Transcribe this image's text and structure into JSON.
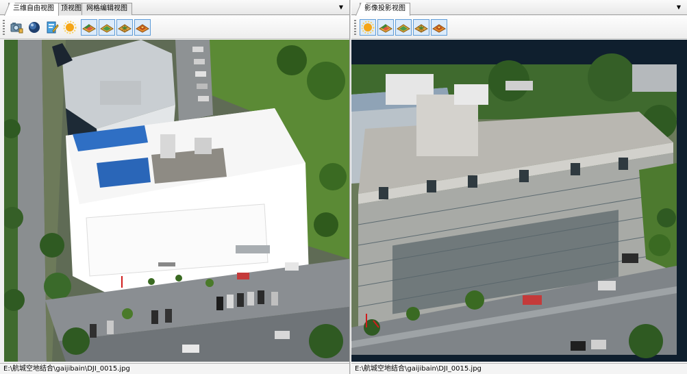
{
  "left_panel": {
    "tabs": [
      {
        "label": "三维自由视图",
        "active": true
      },
      {
        "label": "顶视图",
        "active": false
      },
      {
        "label": "网格编辑视图",
        "active": false
      }
    ],
    "dropdown_icon": "caret-down-icon",
    "toolbar": [
      {
        "icon": "camera-photo-icon",
        "bordered": false
      },
      {
        "icon": "globe-icon",
        "bordered": false
      },
      {
        "icon": "edit-document-icon",
        "bordered": false
      },
      {
        "icon": "sun-light-icon",
        "bordered": false
      },
      {
        "icon": "terrain-layer-icon",
        "bordered": true
      },
      {
        "icon": "terrain-flat-icon",
        "bordered": true
      },
      {
        "icon": "terrain-mesh-icon",
        "bordered": true
      },
      {
        "icon": "terrain-textured-icon",
        "bordered": true
      }
    ],
    "viewport": "3D model view of building and parking area",
    "status_text": "E:\\航城空地结合\\gaijibain\\DJI_0015.jpg"
  },
  "right_panel": {
    "tabs": [
      {
        "label": "影像投影视图",
        "active": true
      }
    ],
    "dropdown_icon": "caret-down-icon",
    "toolbar": [
      {
        "icon": "sun-light-icon",
        "bordered": true
      },
      {
        "icon": "terrain-layer-icon",
        "bordered": true
      },
      {
        "icon": "terrain-flat-icon",
        "bordered": true
      },
      {
        "icon": "terrain-mesh-icon",
        "bordered": true
      },
      {
        "icon": "terrain-textured-icon",
        "bordered": true
      }
    ],
    "viewport": "Aerial photo projection of building",
    "status_text": "E:\\航城空地结合\\gaijibain\\DJI_0015.jpg"
  },
  "colors": {
    "toolbar_button_border": "#5e9cd8",
    "roof_blue": "#2f6fc4",
    "grass": "#4d7a2f",
    "road": "#7f8488",
    "dark_background": "#0f1f2e"
  }
}
